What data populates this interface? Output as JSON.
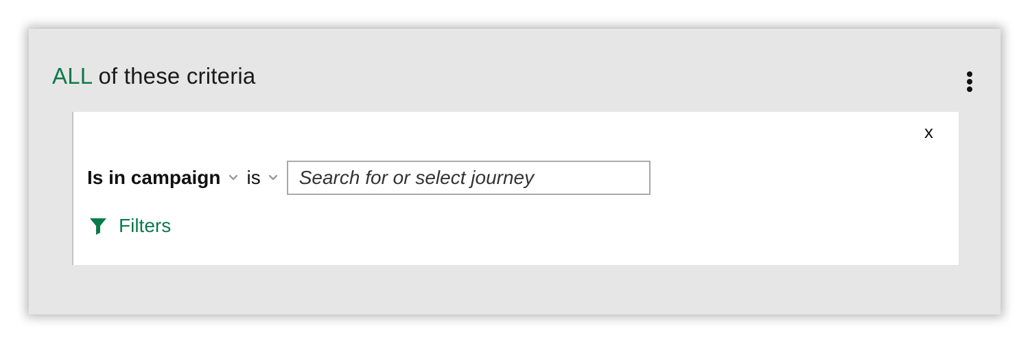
{
  "group": {
    "quantifier": "ALL",
    "title_rest": " of these criteria",
    "menu_icon": "kebab-menu-icon"
  },
  "criterion": {
    "close_label": "x",
    "field_label": "Is in campaign",
    "operator_label": "is",
    "search_placeholder": "Search for or select journey",
    "filters_label": "Filters",
    "filter_icon": "funnel-icon"
  },
  "colors": {
    "accent": "#0b7a4b",
    "panel_bg": "#e6e6e6",
    "card_bg": "#ffffff"
  }
}
